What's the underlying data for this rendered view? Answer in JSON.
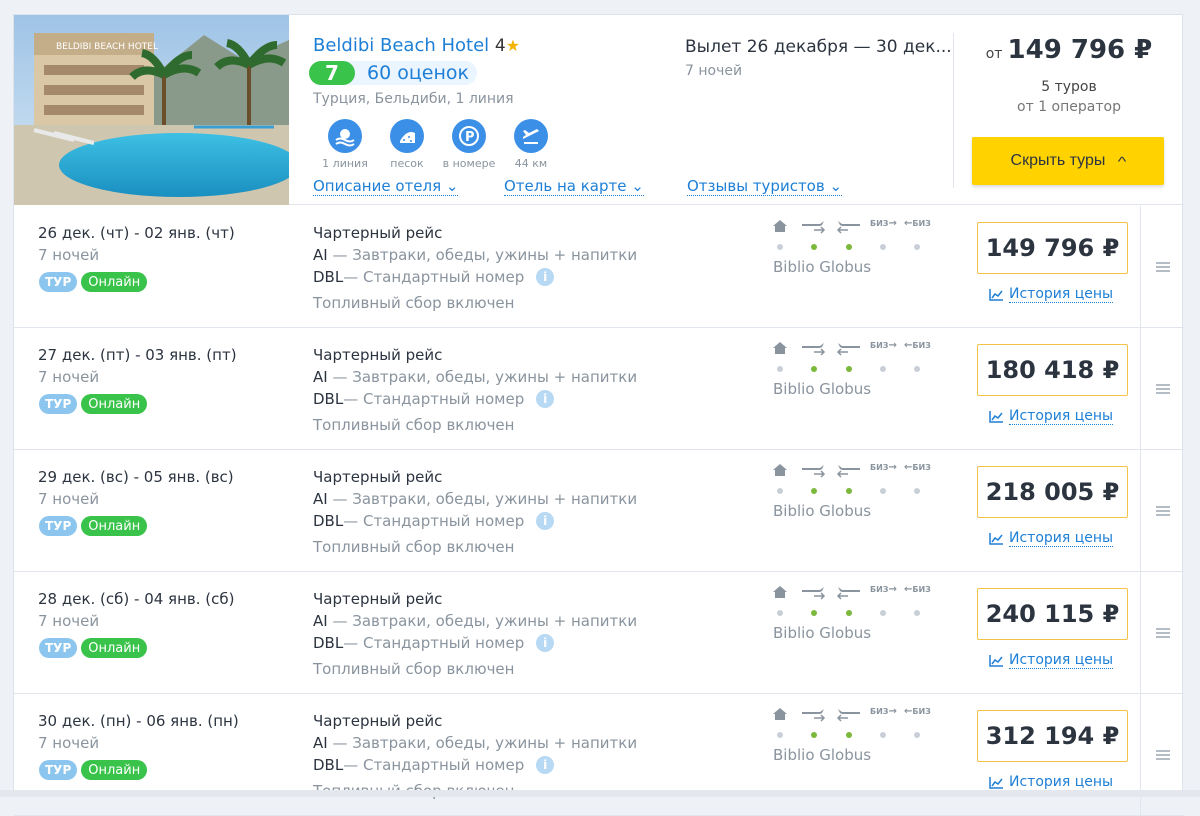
{
  "hotel": {
    "name": "Beldibi Beach Hotel",
    "stars": "4",
    "rating_score": "7",
    "rating_count": "60 оценок",
    "location": "Турция, Бельдиби, 1 линия",
    "photo_sign": "BELDIBI BEACH HOTEL",
    "features": [
      {
        "icon": "beach-line-icon",
        "label": "1 линия"
      },
      {
        "icon": "sand-icon",
        "label": "песок"
      },
      {
        "icon": "parking-icon",
        "label": "в номере"
      },
      {
        "icon": "airport-distance-icon",
        "label": "44 км"
      }
    ],
    "links": {
      "description": "Описание отеля",
      "map": "Отель на карте",
      "reviews": "Отзывы туристов"
    },
    "departure": "Вылет 26 декабря — 30 дек...",
    "nights": "7 ночей",
    "price_from": "от",
    "price": "149 796 ₽",
    "tours_count": "5 туров",
    "operators": "от 1 оператор",
    "hide_button": "Скрыть туры"
  },
  "row_common": {
    "tour_badge": "ТУР",
    "online_badge": "Онлайн",
    "history_label": "История цены",
    "biz_label": "БИЗ"
  },
  "tours": [
    {
      "dates": "26 дек. (чт) - 02 янв. (чт)",
      "nights": "7 ночей",
      "flight": "Чартерный рейс",
      "meal_code": "AI",
      "meal_desc": " — Завтраки, обеды, ужины + напитки",
      "room_code": "DBL",
      "room_desc": " — Стандартный номер",
      "fuel": "Топливный сбор включен",
      "operator": "Biblio Globus",
      "price": "149 796 ₽"
    },
    {
      "dates": "27 дек. (пт) - 03 янв. (пт)",
      "nights": "7 ночей",
      "flight": "Чартерный рейс",
      "meal_code": "AI",
      "meal_desc": " — Завтраки, обеды, ужины + напитки",
      "room_code": "DBL",
      "room_desc": " — Стандартный номер",
      "fuel": "Топливный сбор включен",
      "operator": "Biblio Globus",
      "price": "180 418 ₽"
    },
    {
      "dates": "29 дек. (вс) - 05 янв. (вс)",
      "nights": "7 ночей",
      "flight": "Чартерный рейс",
      "meal_code": "AI",
      "meal_desc": " — Завтраки, обеды, ужины + напитки",
      "room_code": "DBL",
      "room_desc": " — Стандартный номер",
      "fuel": "Топливный сбор включен",
      "operator": "Biblio Globus",
      "price": "218 005 ₽"
    },
    {
      "dates": "28 дек. (сб) - 04 янв. (сб)",
      "nights": "7 ночей",
      "flight": "Чартерный рейс",
      "meal_code": "AI",
      "meal_desc": " — Завтраки, обеды, ужины + напитки",
      "room_code": "DBL",
      "room_desc": " — Стандартный номер",
      "fuel": "Топливный сбор включен",
      "operator": "Biblio Globus",
      "price": "240 115 ₽"
    },
    {
      "dates": "30 дек. (пн) - 06 янв. (пн)",
      "nights": "7 ночей",
      "flight": "Чартерный рейс",
      "meal_code": "AI",
      "meal_desc": " — Завтраки, обеды, ужины + напитки",
      "room_code": "DBL",
      "room_desc": " — Стандартный номер",
      "fuel": "Топливный сбор включен",
      "operator": "Biblio Globus",
      "price": "312 194 ₽"
    }
  ],
  "colors": {
    "accent_blue": "#1e7fd6",
    "rating_green": "#3ac34a",
    "button_yellow": "#ffd200",
    "price_border": "#f3c246"
  }
}
